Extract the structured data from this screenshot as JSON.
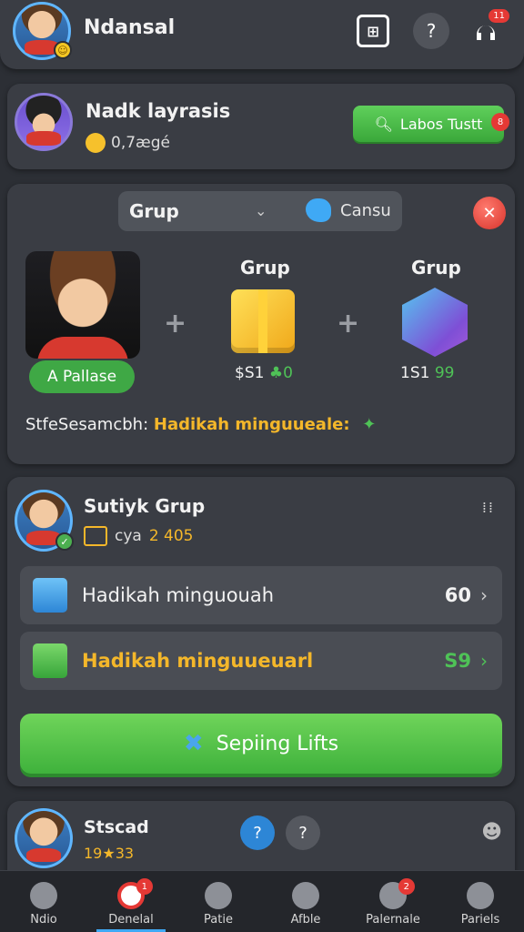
{
  "header": {
    "title": "Ndansal",
    "notification_count": "11"
  },
  "profile": {
    "name": "Nadk layrasis",
    "subtitle": "0,7ægé",
    "action_label": "Labos Tustt",
    "action_badge": "8"
  },
  "gift": {
    "selector_label": "Grup",
    "selector_right_label": "Cansu",
    "avatar_name": "A Pallase",
    "option1": {
      "title": "Grup",
      "price": "$S1",
      "price_extra": "♣0"
    },
    "option2": {
      "title": "Grup",
      "price": "1S1",
      "price_extra": "99"
    },
    "status_prefix": "StfeSesamcbh:",
    "status_value": "Hadikah minguueale:"
  },
  "group": {
    "name": "Sutiyk Grup",
    "subtitle": "cya",
    "count": "2 405",
    "rows": [
      {
        "label": "Hadikah minguouah",
        "value": "60"
      },
      {
        "label": "Hadikah minguueuarl",
        "value": "S9"
      }
    ],
    "button_label": "Sepiing Lifts"
  },
  "bottom_card": {
    "name": "Stscad",
    "score": "19★33"
  },
  "tabs": [
    {
      "label": "Ndio"
    },
    {
      "label": "Denelal",
      "badge": "1"
    },
    {
      "label": "Patie"
    },
    {
      "label": "Afble"
    },
    {
      "label": "Palernale",
      "badge": "2"
    },
    {
      "label": "Pariels"
    }
  ]
}
